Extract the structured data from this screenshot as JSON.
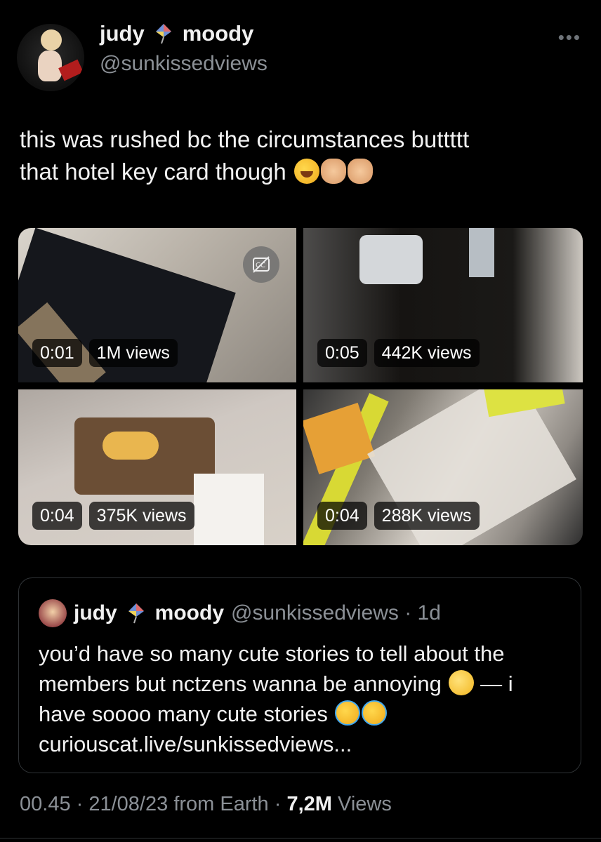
{
  "post": {
    "author_name_part1": "judy",
    "author_name_part2": "moody",
    "handle": "@sunkissedviews",
    "more_label": "•••",
    "text_line1": "this was rushed bc the circumstances buttttt",
    "text_line2": "that hotel key card though"
  },
  "media": [
    {
      "duration": "0:01",
      "views": "1M views",
      "has_cc": true
    },
    {
      "duration": "0:05",
      "views": "442K views",
      "has_cc": false
    },
    {
      "duration": "0:04",
      "views": "375K views",
      "has_cc": false
    },
    {
      "duration": "0:04",
      "views": "288K views",
      "has_cc": false
    }
  ],
  "quote": {
    "name_part1": "judy",
    "name_part2": "moody",
    "handle_time": "@sunkissedviews · 1d",
    "text_line1": "you’d have so many cute stories to tell about the",
    "text_line2": "members but nctzens wanna be annoying",
    "text_line2_tail": "— i",
    "text_line3": "have soooo many cute stories",
    "text_line4": "curiouscat.live/sunkissedviews..."
  },
  "footer": {
    "time": "00.45",
    "date": "21/08/23",
    "source": "from Earth",
    "views_count": "7,2M",
    "views_label": "Views"
  },
  "icons": [
    "kite-icon",
    "more-icon",
    "cc-icon",
    "laughing-emoji",
    "raised-hands-emoji",
    "rolling-eyes-emoji",
    "crying-emoji"
  ],
  "colors": {
    "background": "#000000",
    "text": "#e7e9ea",
    "secondary": "#8b9096",
    "border": "#2f3336"
  }
}
